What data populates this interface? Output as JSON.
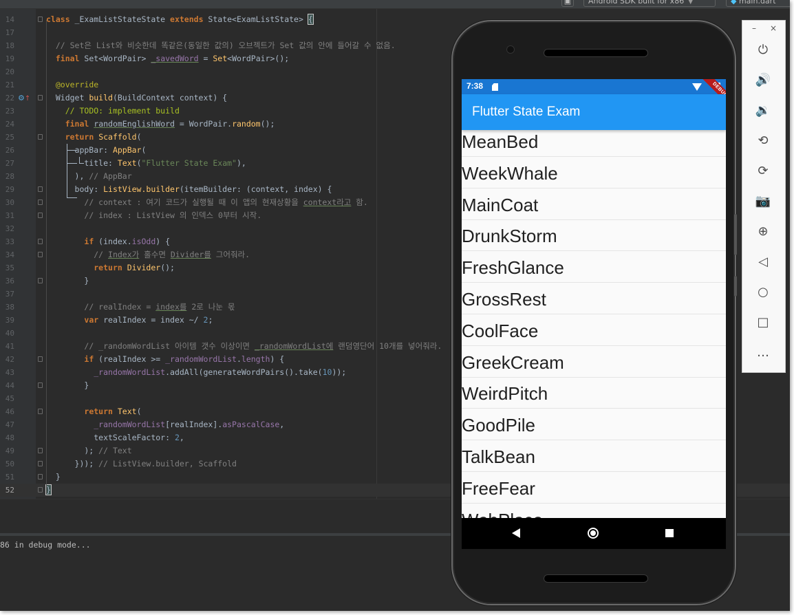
{
  "toolbar": {
    "run_icon": "app-icon",
    "device_label": "Android SDK built for x86",
    "file_label": "main.dart"
  },
  "editor": {
    "current_line": "52",
    "lines": [
      {
        "num": "14",
        "code": "class _ExamListStateState extends State<ExamListState> {"
      },
      {
        "num": "17",
        "code": ""
      },
      {
        "num": "18",
        "code": "  // Set은 List와 비슷한데 똑같은(동일한 값의) 오브젝트가 Set 값의 안에 들어갈 수 없음."
      },
      {
        "num": "19",
        "code": "  final Set<WordPair> _savedWord = Set<WordPair>();"
      },
      {
        "num": "20",
        "code": ""
      },
      {
        "num": "21",
        "code": "  @override"
      },
      {
        "num": "22",
        "code": "  Widget build(BuildContext context) {"
      },
      {
        "num": "23",
        "code": "    // TODO: implement build"
      },
      {
        "num": "24",
        "code": "    final randomEnglishWord = WordPair.random();"
      },
      {
        "num": "25",
        "code": "    return Scaffold("
      },
      {
        "num": "26",
        "code": "      appBar: AppBar("
      },
      {
        "num": "27",
        "code": "        title: Text(\"Flutter State Exam\"),"
      },
      {
        "num": "28",
        "code": "      ), // AppBar"
      },
      {
        "num": "29",
        "code": "      body: ListView.builder(itemBuilder: (context, index) {"
      },
      {
        "num": "30",
        "code": "        // context : 여기 코드가 실행될 때 이 앱의 현재상황을 context라고 함."
      },
      {
        "num": "31",
        "code": "        // index : ListView 의 인덱스 0부터 시작."
      },
      {
        "num": "32",
        "code": ""
      },
      {
        "num": "33",
        "code": "        if (index.isOdd) {"
      },
      {
        "num": "34",
        "code": "          // Index가 홀수면 Divider를 그어줘라."
      },
      {
        "num": "35",
        "code": "          return Divider();"
      },
      {
        "num": "36",
        "code": "        }"
      },
      {
        "num": "37",
        "code": ""
      },
      {
        "num": "38",
        "code": "        // realIndex = index를 2로 나눈 몫"
      },
      {
        "num": "39",
        "code": "        var realIndex = index ~/ 2;"
      },
      {
        "num": "40",
        "code": ""
      },
      {
        "num": "41",
        "code": "        // _randomWordList 아이템 갯수 이상이면 _randomWordList에 랜덤영단어 10개를 넣어줘라."
      },
      {
        "num": "42",
        "code": "        if (realIndex >= _randomWordList.length) {"
      },
      {
        "num": "43",
        "code": "          _randomWordList.addAll(generateWordPairs().take(10));"
      },
      {
        "num": "44",
        "code": "        }"
      },
      {
        "num": "45",
        "code": ""
      },
      {
        "num": "46",
        "code": "        return Text("
      },
      {
        "num": "47",
        "code": "          _randomWordList[realIndex].asPascalCase,"
      },
      {
        "num": "48",
        "code": "          textScaleFactor: 2,"
      },
      {
        "num": "49",
        "code": "        ); // Text"
      },
      {
        "num": "50",
        "code": "      })); // ListView.builder, Scaffold"
      },
      {
        "num": "51",
        "code": "  }"
      },
      {
        "num": "52",
        "code": "}"
      }
    ]
  },
  "console": {
    "text": "86 in debug mode..."
  },
  "phone": {
    "status_time": "7:38",
    "debug_banner": "DEBUG",
    "app_title": "Flutter State Exam",
    "words": [
      "MeanBed",
      "WeekWhale",
      "MainCoat",
      "DrunkStorm",
      "FreshGlance",
      "GrossRest",
      "CoolFace",
      "GreekCream",
      "WeirdPitch",
      "GoodPile",
      "TalkBean",
      "FreeFear",
      "WebPlace"
    ],
    "nav": [
      "back-icon",
      "home-icon",
      "recents-icon"
    ]
  },
  "emulator_panel": {
    "window_controls": [
      "–",
      "×"
    ],
    "buttons": [
      {
        "name": "power-button",
        "glyph": "⏻"
      },
      {
        "name": "volume-up-button",
        "glyph": "🔊"
      },
      {
        "name": "volume-down-button",
        "glyph": "🔉"
      },
      {
        "name": "rotate-left-button",
        "glyph": "⟲"
      },
      {
        "name": "rotate-right-button",
        "glyph": "⟳"
      },
      {
        "name": "screenshot-button",
        "glyph": "📷"
      },
      {
        "name": "zoom-button",
        "glyph": "⊕"
      },
      {
        "name": "back-button",
        "glyph": "◁"
      },
      {
        "name": "home-button",
        "glyph": "○"
      },
      {
        "name": "overview-button",
        "glyph": "□"
      },
      {
        "name": "more-button",
        "glyph": "…"
      }
    ]
  }
}
